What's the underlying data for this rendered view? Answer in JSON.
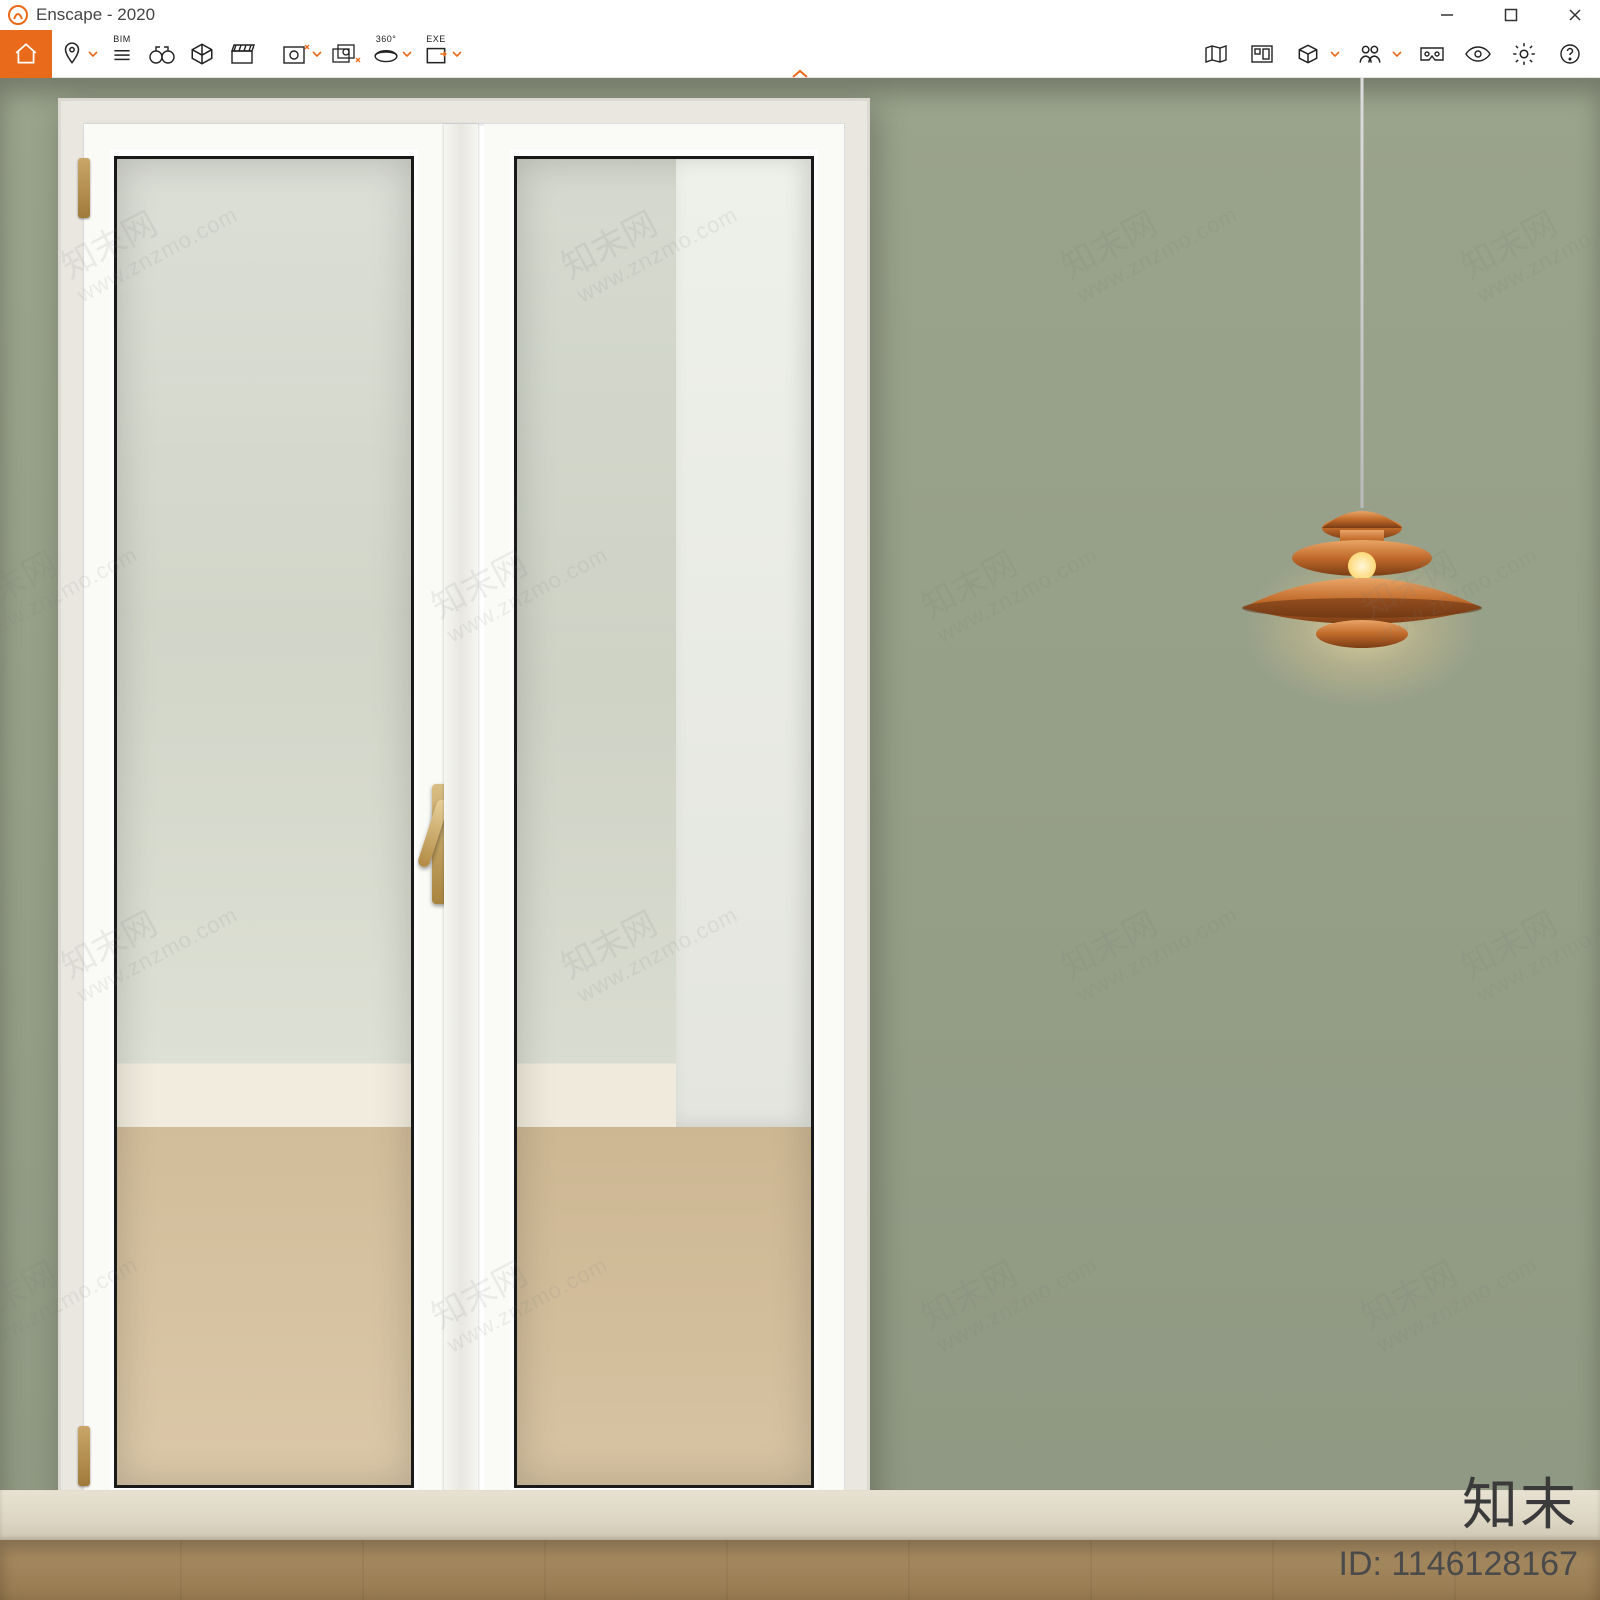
{
  "window": {
    "title": "Enscape - 2020"
  },
  "toolbar": {
    "bim_label": "BIM",
    "pano_label": "360°",
    "exe_label": "EXE"
  },
  "overlay": {
    "brand": "知末",
    "id_label": "ID: 1146128167"
  },
  "watermark": {
    "text": "知末网",
    "url": "www.znzmo.com"
  },
  "colors": {
    "accent": "#e86a1a",
    "wall": "#97a08a",
    "lamp": "#c06a2a"
  }
}
